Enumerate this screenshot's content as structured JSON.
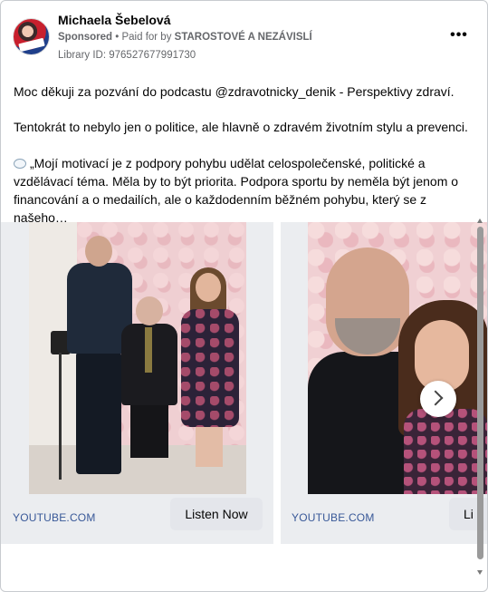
{
  "post": {
    "author": "Michaela Šebelová",
    "sponsored": "Sponsored",
    "paid_prefix": " • Paid for by ",
    "payer": "STAROSTOVÉ A NEZÁVISLÍ",
    "library_id": "Library ID: 976527677991730",
    "more_label": "•••"
  },
  "body": {
    "line1": "Moc děkuji za pozvání do podcastu @zdravotnicky_denik - Perspektivy zdraví.",
    "line2": "Tentokrát to nebylo jen o politice, ale hlavně o zdravém životním stylu a prevenci.",
    "line3": "„Mojí motivací je z podpory pohybu udělat celospolečenské, politické a vzdělávací téma. Měla by to být priorita. Podpora sportu by neměla být jenom o financování a o medailích, ale o každodenním běžném pohybu, který se z našeho…",
    "emoji_icon": "speech-bubble-icon"
  },
  "carousel": {
    "cards": [
      {
        "domain": "YOUTUBE.COM",
        "cta": "Listen Now"
      },
      {
        "domain": "YOUTUBE.COM",
        "cta": "Li"
      }
    ],
    "next_icon": "chevron-right-icon"
  },
  "colors": {
    "link_blue": "#385898",
    "text": "#050505",
    "secondary": "#65676b",
    "button_bg": "#e4e6eb"
  }
}
